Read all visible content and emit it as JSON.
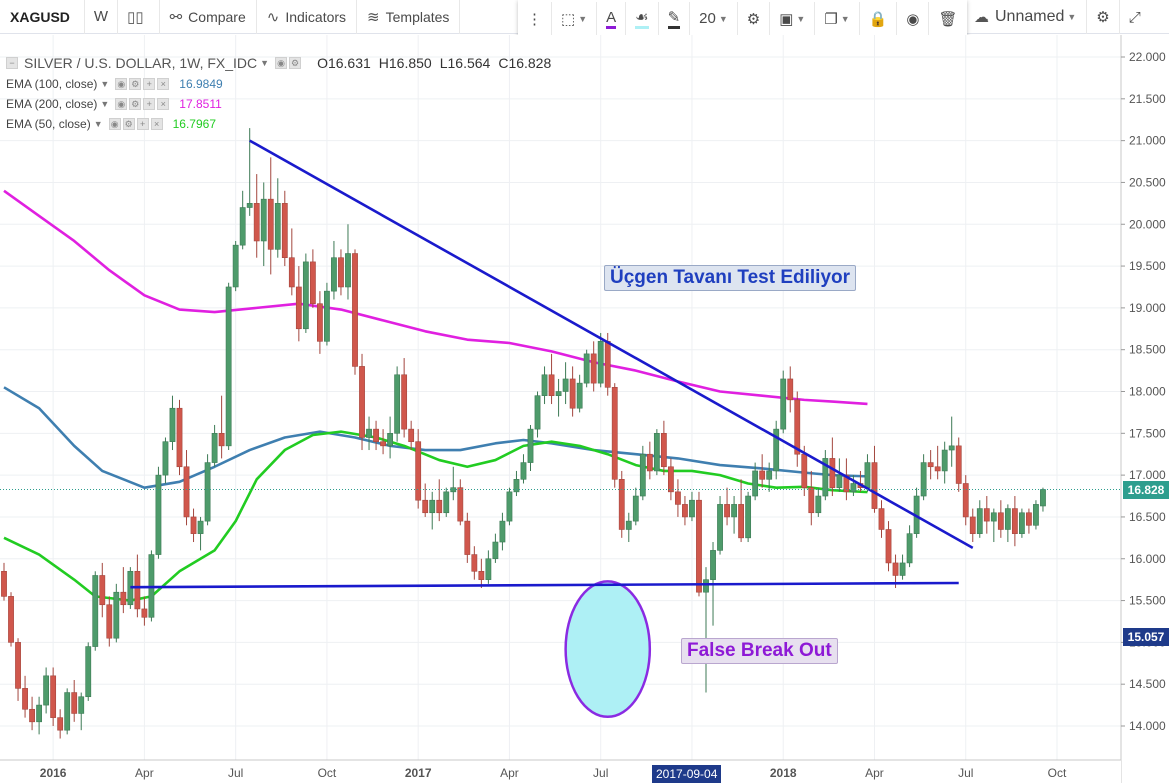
{
  "toolbar": {
    "symbol": "XAGUSD",
    "interval": "W",
    "compare": "Compare",
    "indicators": "Indicators",
    "templates": "Templates",
    "line_width": "20",
    "layout_name": "Unnamed"
  },
  "legend": {
    "title": "SILVER / U.S. DOLLAR, 1W, FX_IDC",
    "open": "O16.631",
    "high": "H16.850",
    "low": "L16.564",
    "close": "C16.828",
    "studies": [
      {
        "label": "EMA (100, close)",
        "value": "16.9849",
        "color": "#3f7fb0"
      },
      {
        "label": "EMA (200, close)",
        "value": "17.8511",
        "color": "#e020e0"
      },
      {
        "label": "EMA (50, close)",
        "value": "16.7967",
        "color": "#22cc22"
      }
    ]
  },
  "annotations": {
    "triangle_top": "Üçgen Tavanı Test Ediliyor",
    "false_break": "False Break Out"
  },
  "price_axis": {
    "last_price": "16.828",
    "crosshair_price": "15.057"
  },
  "time_axis": {
    "crosshair_date": "2017-09-04"
  },
  "colors": {
    "up": "#4e9b6b",
    "down": "#d0574c",
    "trendline": "#1a1acc",
    "ellipse_fill": "#aef0f5",
    "ellipse_stroke": "#8a2be2"
  },
  "chart_data": {
    "type": "candlestick",
    "title": "SILVER / U.S. DOLLAR, 1W, FX_IDC",
    "ylim": [
      13.7,
      22.2
    ],
    "y_ticks": [
      "22.000",
      "21.500",
      "21.000",
      "20.500",
      "20.000",
      "19.500",
      "19.000",
      "18.500",
      "18.000",
      "17.500",
      "17.000",
      "16.500",
      "16.000",
      "15.500",
      "15.000",
      "14.500",
      "14.000"
    ],
    "x_ticks": [
      {
        "label": "2016",
        "week": 7,
        "bold": true
      },
      {
        "label": "Apr",
        "week": 20
      },
      {
        "label": "Jul",
        "week": 33
      },
      {
        "label": "Oct",
        "week": 46
      },
      {
        "label": "2017",
        "week": 59,
        "bold": true
      },
      {
        "label": "Apr",
        "week": 72
      },
      {
        "label": "Jul",
        "week": 85
      },
      {
        "label": "Oct",
        "week": 98
      },
      {
        "label": "2018",
        "week": 111,
        "bold": true
      },
      {
        "label": "Apr",
        "week": 124
      },
      {
        "label": "Jul",
        "week": 137
      },
      {
        "label": "Oct",
        "week": 150
      }
    ],
    "candles": [
      [
        15.85,
        15.95,
        15.5,
        15.55
      ],
      [
        15.55,
        15.6,
        14.95,
        15.0
      ],
      [
        15.0,
        15.05,
        14.3,
        14.45
      ],
      [
        14.45,
        14.6,
        14.1,
        14.2
      ],
      [
        14.2,
        14.35,
        13.95,
        14.05
      ],
      [
        14.05,
        14.35,
        13.9,
        14.25
      ],
      [
        14.25,
        14.7,
        14.15,
        14.6
      ],
      [
        14.6,
        14.7,
        14.0,
        14.1
      ],
      [
        14.1,
        14.2,
        13.85,
        13.95
      ],
      [
        13.95,
        14.45,
        13.9,
        14.4
      ],
      [
        14.4,
        14.55,
        14.05,
        14.15
      ],
      [
        14.15,
        14.4,
        13.95,
        14.35
      ],
      [
        14.35,
        15.0,
        14.3,
        14.95
      ],
      [
        14.95,
        15.85,
        14.9,
        15.8
      ],
      [
        15.8,
        15.95,
        15.3,
        15.45
      ],
      [
        15.45,
        15.55,
        14.95,
        15.05
      ],
      [
        15.05,
        15.7,
        15.0,
        15.6
      ],
      [
        15.6,
        15.9,
        15.35,
        15.45
      ],
      [
        15.45,
        15.9,
        15.4,
        15.85
      ],
      [
        15.85,
        16.05,
        15.3,
        15.4
      ],
      [
        15.4,
        15.55,
        15.2,
        15.3
      ],
      [
        15.3,
        16.1,
        15.25,
        16.05
      ],
      [
        16.05,
        17.1,
        16.0,
        17.0
      ],
      [
        17.0,
        17.45,
        16.9,
        17.4
      ],
      [
        17.4,
        17.95,
        17.3,
        17.8
      ],
      [
        17.8,
        17.9,
        17.0,
        17.1
      ],
      [
        17.1,
        17.3,
        16.4,
        16.5
      ],
      [
        16.5,
        16.6,
        16.2,
        16.3
      ],
      [
        16.3,
        16.5,
        16.1,
        16.45
      ],
      [
        16.45,
        17.25,
        16.4,
        17.15
      ],
      [
        17.15,
        17.6,
        17.1,
        17.5
      ],
      [
        17.5,
        17.95,
        17.2,
        17.35
      ],
      [
        17.35,
        19.3,
        17.3,
        19.25
      ],
      [
        19.25,
        19.8,
        19.2,
        19.75
      ],
      [
        19.75,
        20.4,
        19.7,
        20.2
      ],
      [
        20.2,
        21.15,
        20.1,
        20.25
      ],
      [
        20.25,
        20.6,
        19.6,
        19.8
      ],
      [
        19.8,
        20.5,
        19.5,
        20.3
      ],
      [
        20.3,
        20.8,
        19.4,
        19.7
      ],
      [
        19.7,
        20.55,
        19.6,
        20.25
      ],
      [
        20.25,
        20.4,
        19.5,
        19.6
      ],
      [
        19.6,
        19.95,
        19.15,
        19.25
      ],
      [
        19.25,
        19.5,
        18.6,
        18.75
      ],
      [
        18.75,
        19.65,
        18.7,
        19.55
      ],
      [
        19.55,
        19.7,
        19.0,
        19.05
      ],
      [
        19.05,
        19.2,
        18.45,
        18.6
      ],
      [
        18.6,
        19.3,
        18.55,
        19.2
      ],
      [
        19.2,
        19.8,
        19.1,
        19.6
      ],
      [
        19.6,
        19.7,
        19.15,
        19.25
      ],
      [
        19.25,
        20.0,
        19.1,
        19.65
      ],
      [
        19.65,
        19.7,
        18.2,
        18.3
      ],
      [
        18.3,
        18.45,
        17.3,
        17.45
      ],
      [
        17.45,
        17.7,
        17.3,
        17.55
      ],
      [
        17.55,
        17.65,
        17.3,
        17.4
      ],
      [
        17.4,
        17.55,
        17.25,
        17.35
      ],
      [
        17.35,
        17.7,
        17.2,
        17.5
      ],
      [
        17.5,
        18.3,
        17.4,
        18.2
      ],
      [
        18.2,
        18.4,
        17.45,
        17.55
      ],
      [
        17.55,
        17.65,
        17.3,
        17.4
      ],
      [
        17.4,
        17.55,
        16.6,
        16.7
      ],
      [
        16.7,
        16.9,
        16.5,
        16.55
      ],
      [
        16.55,
        16.8,
        16.35,
        16.7
      ],
      [
        16.7,
        16.95,
        16.45,
        16.55
      ],
      [
        16.55,
        16.85,
        16.5,
        16.8
      ],
      [
        16.8,
        17.1,
        16.7,
        16.85
      ],
      [
        16.85,
        16.95,
        16.4,
        16.45
      ],
      [
        16.45,
        16.55,
        15.95,
        16.05
      ],
      [
        16.05,
        16.15,
        15.75,
        15.85
      ],
      [
        15.85,
        16.0,
        15.65,
        15.75
      ],
      [
        15.75,
        16.1,
        15.7,
        16.0
      ],
      [
        16.0,
        16.3,
        15.95,
        16.2
      ],
      [
        16.2,
        16.55,
        16.1,
        16.45
      ],
      [
        16.45,
        16.85,
        16.4,
        16.8
      ],
      [
        16.8,
        17.05,
        16.75,
        16.95
      ],
      [
        16.95,
        17.25,
        16.9,
        17.15
      ],
      [
        17.15,
        17.6,
        17.05,
        17.55
      ],
      [
        17.55,
        18.0,
        17.45,
        17.95
      ],
      [
        17.95,
        18.3,
        17.85,
        18.2
      ],
      [
        18.2,
        18.45,
        17.85,
        17.95
      ],
      [
        17.95,
        18.15,
        17.7,
        18.0
      ],
      [
        18.0,
        18.35,
        17.85,
        18.15
      ],
      [
        18.15,
        18.3,
        17.7,
        17.8
      ],
      [
        17.8,
        18.2,
        17.75,
        18.1
      ],
      [
        18.1,
        18.5,
        18.05,
        18.45
      ],
      [
        18.45,
        18.6,
        18.0,
        18.1
      ],
      [
        18.1,
        18.7,
        18.05,
        18.6
      ],
      [
        18.6,
        18.7,
        17.95,
        18.05
      ],
      [
        18.05,
        18.1,
        16.85,
        16.95
      ],
      [
        16.95,
        17.05,
        16.25,
        16.35
      ],
      [
        16.35,
        16.55,
        16.2,
        16.45
      ],
      [
        16.45,
        16.85,
        16.4,
        16.75
      ],
      [
        16.75,
        17.35,
        16.7,
        17.25
      ],
      [
        17.25,
        17.4,
        16.95,
        17.05
      ],
      [
        17.05,
        17.55,
        17.0,
        17.5
      ],
      [
        17.5,
        17.65,
        17.0,
        17.1
      ],
      [
        17.1,
        17.2,
        16.7,
        16.8
      ],
      [
        16.8,
        16.95,
        16.5,
        16.65
      ],
      [
        16.65,
        16.75,
        16.4,
        16.5
      ],
      [
        16.5,
        16.8,
        16.45,
        16.7
      ],
      [
        16.7,
        16.8,
        15.55,
        15.6
      ],
      [
        15.6,
        15.9,
        14.4,
        15.75
      ],
      [
        15.75,
        16.2,
        15.2,
        16.1
      ],
      [
        16.1,
        16.75,
        16.05,
        16.65
      ],
      [
        16.65,
        16.85,
        16.4,
        16.5
      ],
      [
        16.5,
        16.75,
        16.3,
        16.65
      ],
      [
        16.65,
        16.95,
        16.2,
        16.25
      ],
      [
        16.25,
        16.8,
        16.2,
        16.75
      ],
      [
        16.75,
        17.15,
        16.7,
        17.05
      ],
      [
        17.05,
        17.25,
        16.85,
        16.95
      ],
      [
        16.95,
        17.15,
        16.8,
        17.05
      ],
      [
        17.05,
        17.65,
        16.95,
        17.55
      ],
      [
        17.55,
        18.25,
        17.5,
        18.15
      ],
      [
        18.15,
        18.3,
        17.75,
        17.9
      ],
      [
        17.9,
        18.0,
        17.1,
        17.25
      ],
      [
        17.25,
        17.35,
        16.75,
        16.85
      ],
      [
        16.85,
        17.05,
        16.4,
        16.55
      ],
      [
        16.55,
        16.85,
        16.5,
        16.75
      ],
      [
        16.75,
        17.3,
        16.7,
        17.2
      ],
      [
        17.2,
        17.45,
        16.75,
        16.85
      ],
      [
        16.85,
        17.2,
        16.8,
        17.0
      ],
      [
        17.0,
        17.2,
        16.7,
        16.8
      ],
      [
        16.8,
        17.0,
        16.75,
        16.9
      ],
      [
        16.9,
        17.05,
        16.8,
        16.85
      ],
      [
        16.85,
        17.25,
        16.8,
        17.15
      ],
      [
        17.15,
        17.35,
        16.55,
        16.6
      ],
      [
        16.6,
        16.7,
        16.25,
        16.35
      ],
      [
        16.35,
        16.45,
        15.85,
        15.95
      ],
      [
        15.95,
        16.05,
        15.65,
        15.8
      ],
      [
        15.8,
        16.05,
        15.75,
        15.95
      ],
      [
        15.95,
        16.4,
        15.9,
        16.3
      ],
      [
        16.3,
        16.85,
        16.25,
        16.75
      ],
      [
        16.75,
        17.25,
        16.7,
        17.15
      ],
      [
        17.15,
        17.3,
        16.95,
        17.1
      ],
      [
        17.1,
        17.35,
        16.95,
        17.05
      ],
      [
        17.05,
        17.4,
        16.9,
        17.3
      ],
      [
        17.3,
        17.7,
        17.1,
        17.35
      ],
      [
        17.35,
        17.45,
        16.8,
        16.9
      ],
      [
        16.9,
        17.0,
        16.4,
        16.5
      ],
      [
        16.5,
        16.6,
        16.2,
        16.3
      ],
      [
        16.3,
        16.7,
        16.25,
        16.6
      ],
      [
        16.6,
        16.75,
        16.3,
        16.45
      ],
      [
        16.45,
        16.6,
        16.2,
        16.55
      ],
      [
        16.55,
        16.7,
        16.25,
        16.35
      ],
      [
        16.35,
        16.65,
        16.2,
        16.6
      ],
      [
        16.6,
        16.75,
        16.15,
        16.3
      ],
      [
        16.3,
        16.6,
        16.25,
        16.55
      ],
      [
        16.55,
        16.6,
        16.3,
        16.4
      ],
      [
        16.4,
        16.7,
        16.35,
        16.65
      ],
      [
        16.631,
        16.85,
        16.564,
        16.828
      ]
    ],
    "ema_50": [
      [
        0,
        16.25
      ],
      [
        5,
        16.05
      ],
      [
        10,
        15.75
      ],
      [
        13,
        15.55
      ],
      [
        18,
        15.5
      ],
      [
        21,
        15.55
      ],
      [
        25,
        15.85
      ],
      [
        30,
        16.1
      ],
      [
        33,
        16.45
      ],
      [
        36,
        16.95
      ],
      [
        40,
        17.3
      ],
      [
        44,
        17.48
      ],
      [
        48,
        17.52
      ],
      [
        53,
        17.45
      ],
      [
        57,
        17.35
      ],
      [
        62,
        17.18
      ],
      [
        66,
        17.1
      ],
      [
        70,
        17.18
      ],
      [
        74,
        17.35
      ],
      [
        78,
        17.4
      ],
      [
        82,
        17.35
      ],
      [
        86,
        17.25
      ],
      [
        90,
        17.12
      ],
      [
        94,
        17.05
      ],
      [
        98,
        17.05
      ],
      [
        102,
        17.0
      ],
      [
        106,
        16.9
      ],
      [
        110,
        16.85
      ],
      [
        114,
        16.86
      ],
      [
        118,
        16.82
      ],
      [
        123,
        16.7967
      ]
    ],
    "ema_100": [
      [
        0,
        18.05
      ],
      [
        5,
        17.8
      ],
      [
        10,
        17.35
      ],
      [
        14,
        17.05
      ],
      [
        20,
        16.85
      ],
      [
        25,
        16.92
      ],
      [
        30,
        17.1
      ],
      [
        35,
        17.3
      ],
      [
        40,
        17.45
      ],
      [
        45,
        17.52
      ],
      [
        50,
        17.45
      ],
      [
        55,
        17.35
      ],
      [
        60,
        17.3
      ],
      [
        65,
        17.3
      ],
      [
        70,
        17.38
      ],
      [
        74,
        17.42
      ],
      [
        78,
        17.38
      ],
      [
        84,
        17.3
      ],
      [
        90,
        17.25
      ],
      [
        96,
        17.2
      ],
      [
        102,
        17.12
      ],
      [
        108,
        17.08
      ],
      [
        114,
        17.03
      ],
      [
        118,
        17.0
      ],
      [
        123,
        16.9849
      ]
    ],
    "ema_200": [
      [
        0,
        20.4
      ],
      [
        5,
        20.1
      ],
      [
        10,
        19.8
      ],
      [
        15,
        19.45
      ],
      [
        20,
        19.15
      ],
      [
        25,
        18.98
      ],
      [
        30,
        18.95
      ],
      [
        36,
        19.0
      ],
      [
        42,
        19.05
      ],
      [
        48,
        18.98
      ],
      [
        54,
        18.85
      ],
      [
        60,
        18.72
      ],
      [
        66,
        18.62
      ],
      [
        72,
        18.58
      ],
      [
        78,
        18.48
      ],
      [
        84,
        18.35
      ],
      [
        90,
        18.25
      ],
      [
        96,
        18.12
      ],
      [
        102,
        18.0
      ],
      [
        108,
        17.95
      ],
      [
        114,
        17.9
      ],
      [
        118,
        17.88
      ],
      [
        123,
        17.8511
      ]
    ],
    "lines": [
      {
        "name": "triangle-ceiling",
        "from": [
          35,
          21.0
        ],
        "to": [
          138,
          16.13
        ]
      },
      {
        "name": "triangle-floor",
        "from": [
          18,
          15.66
        ],
        "to": [
          136,
          15.71
        ]
      }
    ],
    "highlight": {
      "name": "false-breakout",
      "center": [
        86,
        14.92
      ],
      "rx": 5,
      "ry": 0.81
    },
    "current_price": 16.828
  }
}
